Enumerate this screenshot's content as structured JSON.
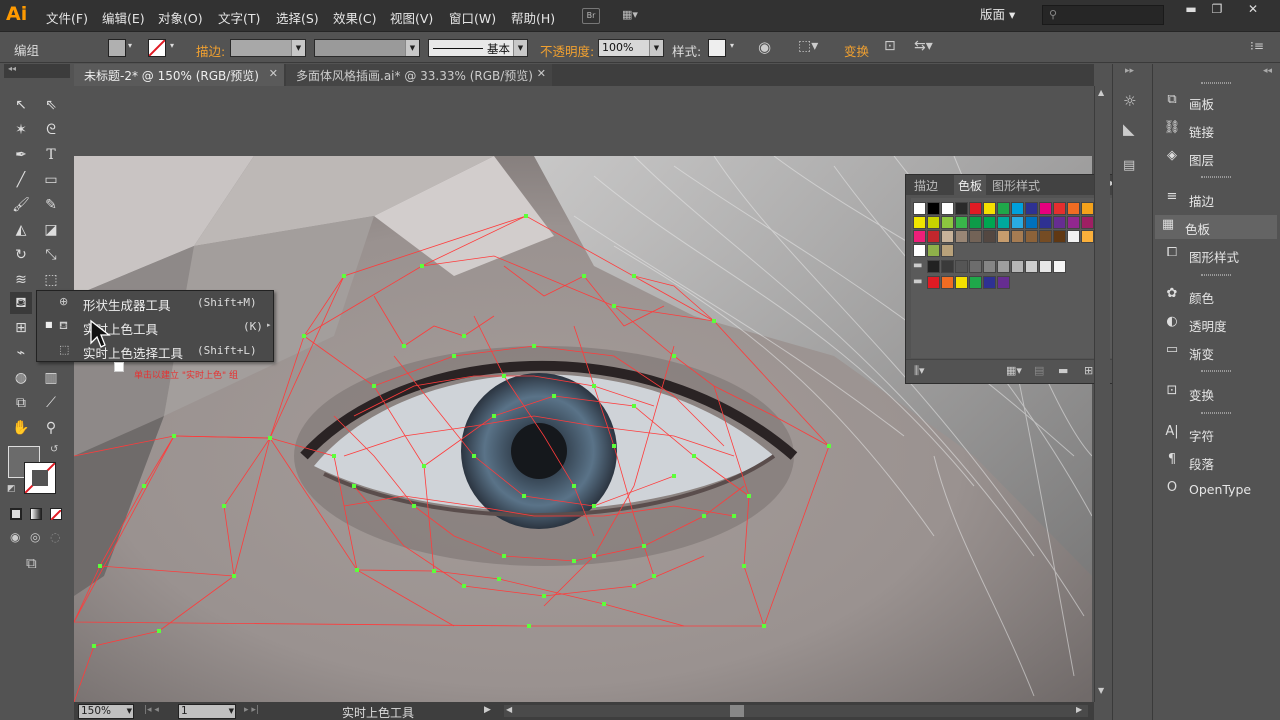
{
  "app": {
    "logo": "Ai"
  },
  "menu": [
    "文件(F)",
    "编辑(E)",
    "对象(O)",
    "文字(T)",
    "选择(S)",
    "效果(C)",
    "视图(V)",
    "窗口(W)",
    "帮助(H)"
  ],
  "menubar": {
    "bridge": "Br",
    "workspace": "版面",
    "search_placeholder": ""
  },
  "control": {
    "selection_label": "编组",
    "stroke_label": "描边:",
    "stroke_style": "基本",
    "opacity_label": "不透明度:",
    "opacity_value": "100%",
    "style_label": "样式:",
    "transform_label": "变换"
  },
  "tabs": [
    {
      "label": "未标题-2* @ 150% (RGB/预览)"
    },
    {
      "label": "多面体风格插画.ai* @ 33.33% (RGB/预览)"
    }
  ],
  "flyout": {
    "items": [
      {
        "name": "形状生成器工具",
        "shortcut": "(Shift+M)"
      },
      {
        "name": "实时上色工具",
        "shortcut": "(K)"
      },
      {
        "name": "实时上色选择工具",
        "shortcut": "(Shift+L)"
      }
    ],
    "tooltip": "单击以建立 \"实时上色\" 组"
  },
  "swatches_panel": {
    "tabs": [
      "描边",
      "色板",
      "图形样式"
    ],
    "rows": [
      [
        "#ffffff",
        "#000000",
        "#ffffff",
        "#2a2a2a",
        "#e01b24",
        "#f5e000",
        "#1fa84a",
        "#00a0dc",
        "#2e3192",
        "#e6007e",
        "#e52e2e",
        "#f06c23",
        "#f4a21b",
        "#f7c21b"
      ],
      [
        "#f0e500",
        "#c7d300",
        "#8cc63f",
        "#39b54a",
        "#0d9b48",
        "#00a651",
        "#00a99d",
        "#29abe2",
        "#0071bc",
        "#2e3192",
        "#662d91",
        "#92278f",
        "#9e1f63",
        "#d4145a"
      ],
      [
        "#ed1e79",
        "#c1272d",
        "#c7b299",
        "#998675",
        "#736357",
        "#534741",
        "#c69c6d",
        "#a67c52",
        "#8c6239",
        "#754c24",
        "#603813",
        "#f2f2f2",
        "#fbb03b",
        "#88c5ea"
      ],
      [
        "#ffffff",
        "#8fb04a",
        "#b8a17a"
      ],
      [
        "#222222",
        "#3a3a3a",
        "#555555",
        "#6d6d6d",
        "#858585",
        "#9e9e9e",
        "#b6b6b6",
        "#cecece",
        "#e6e6e6",
        "#f5f5f5"
      ],
      [
        "#e01b24",
        "#f06c23",
        "#f5e000",
        "#1fa84a",
        "#2e3192",
        "#662d91"
      ]
    ]
  },
  "dock": {
    "items": [
      {
        "label": "画板",
        "icon": "artboard-icon"
      },
      {
        "label": "链接",
        "icon": "link-icon"
      },
      {
        "label": "图层",
        "icon": "layers-icon"
      },
      {
        "label": "描边",
        "icon": "stroke-icon"
      },
      {
        "label": "色板",
        "icon": "swatches-icon"
      },
      {
        "label": "图形样式",
        "icon": "graphic-styles-icon"
      },
      {
        "label": "颜色",
        "icon": "color-icon"
      },
      {
        "label": "透明度",
        "icon": "transparency-icon"
      },
      {
        "label": "渐变",
        "icon": "gradient-icon"
      },
      {
        "label": "变换",
        "icon": "transform-icon"
      },
      {
        "label": "字符",
        "icon": "character-icon"
      },
      {
        "label": "段落",
        "icon": "paragraph-icon"
      },
      {
        "label": "OpenType",
        "icon": "opentype-icon"
      }
    ]
  },
  "status": {
    "zoom": "150%",
    "page": "1",
    "tool_name": "实时上色工具"
  }
}
